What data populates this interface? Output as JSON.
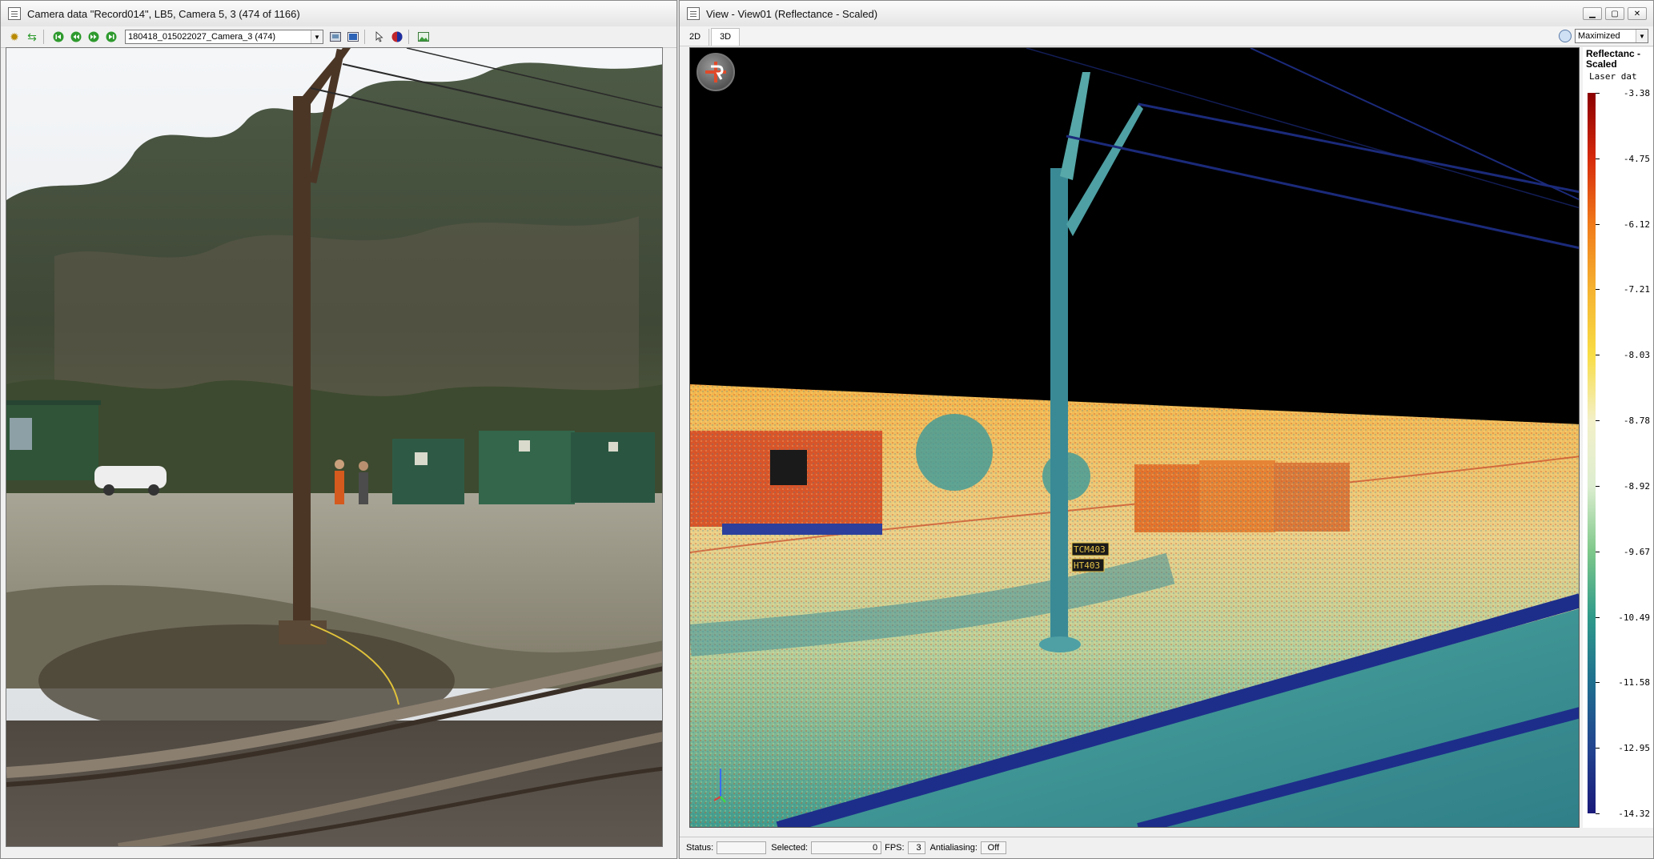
{
  "camera_window": {
    "title": "Camera data \"Record014\", LB5, Camera 5, 3 (474 of 1166)",
    "image_selector": "180418_015022027_Camera_3 (474)"
  },
  "view_window": {
    "title": "View - View01 (Reflectance - Scaled)",
    "tabs": [
      "2D",
      "3D"
    ],
    "active_tab": "3D",
    "layout_selector": "Maximized",
    "labels": [
      "TCM403",
      "HT403"
    ],
    "legend": {
      "title": "Reflectanc - Scaled",
      "subtitle": "Laser dat",
      "ticks": [
        "-3.38",
        "-4.75",
        "-6.12",
        "-7.21",
        "-8.03",
        "-8.78",
        "-8.92",
        "-9.67",
        "-10.49",
        "-11.58",
        "-12.95",
        "-14.32"
      ],
      "colors": [
        "#8b0000",
        "#d62a0c",
        "#f07a1a",
        "#f5b230",
        "#f8dd45",
        "#f3f0c8",
        "#ddeed0",
        "#7ec88a",
        "#2f9a8a",
        "#1f6f8f",
        "#22448f",
        "#1a1a7a"
      ]
    },
    "status": {
      "status_label": "Status:",
      "status_value": "",
      "selected_label": "Selected:",
      "selected_value": "0",
      "fps_label": "FPS:",
      "fps_value": "3",
      "aa_label": "Antialiasing:",
      "aa_value": "Off"
    }
  }
}
